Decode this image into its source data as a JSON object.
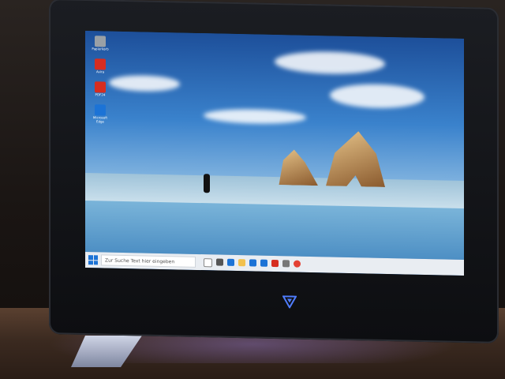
{
  "desktop": {
    "icons": [
      {
        "label": "Papierkorb",
        "icon": "recycle-bin-icon",
        "color": "#9aa0a6"
      },
      {
        "label": "Avira",
        "icon": "avira-icon",
        "color": "#d62d20"
      },
      {
        "label": "PDF24",
        "icon": "pdf-icon",
        "color": "#d62d20"
      },
      {
        "label": "Microsoft Edge",
        "icon": "edge-icon",
        "color": "#1c73d6"
      }
    ]
  },
  "taskbar": {
    "search_placeholder": "Zur Suche Text hier eingeben",
    "apps": [
      {
        "icon": "cortana-icon",
        "color": "#ffffff"
      },
      {
        "icon": "task-view-icon",
        "color": "#555555"
      },
      {
        "icon": "edge-icon",
        "color": "#1c73d6"
      },
      {
        "icon": "explorer-icon",
        "color": "#f2c14e"
      },
      {
        "icon": "store-icon",
        "color": "#1c73d6"
      },
      {
        "icon": "mail-icon",
        "color": "#1c73d6"
      },
      {
        "icon": "pdf-icon",
        "color": "#d62d20"
      },
      {
        "icon": "settings-icon",
        "color": "#777777"
      },
      {
        "icon": "chrome-icon",
        "color": "#e44134"
      }
    ],
    "tray": {
      "time": "",
      "date": ""
    }
  },
  "colors": {
    "accent": "#1c73d6",
    "logo_glow": "#4f7dff"
  }
}
